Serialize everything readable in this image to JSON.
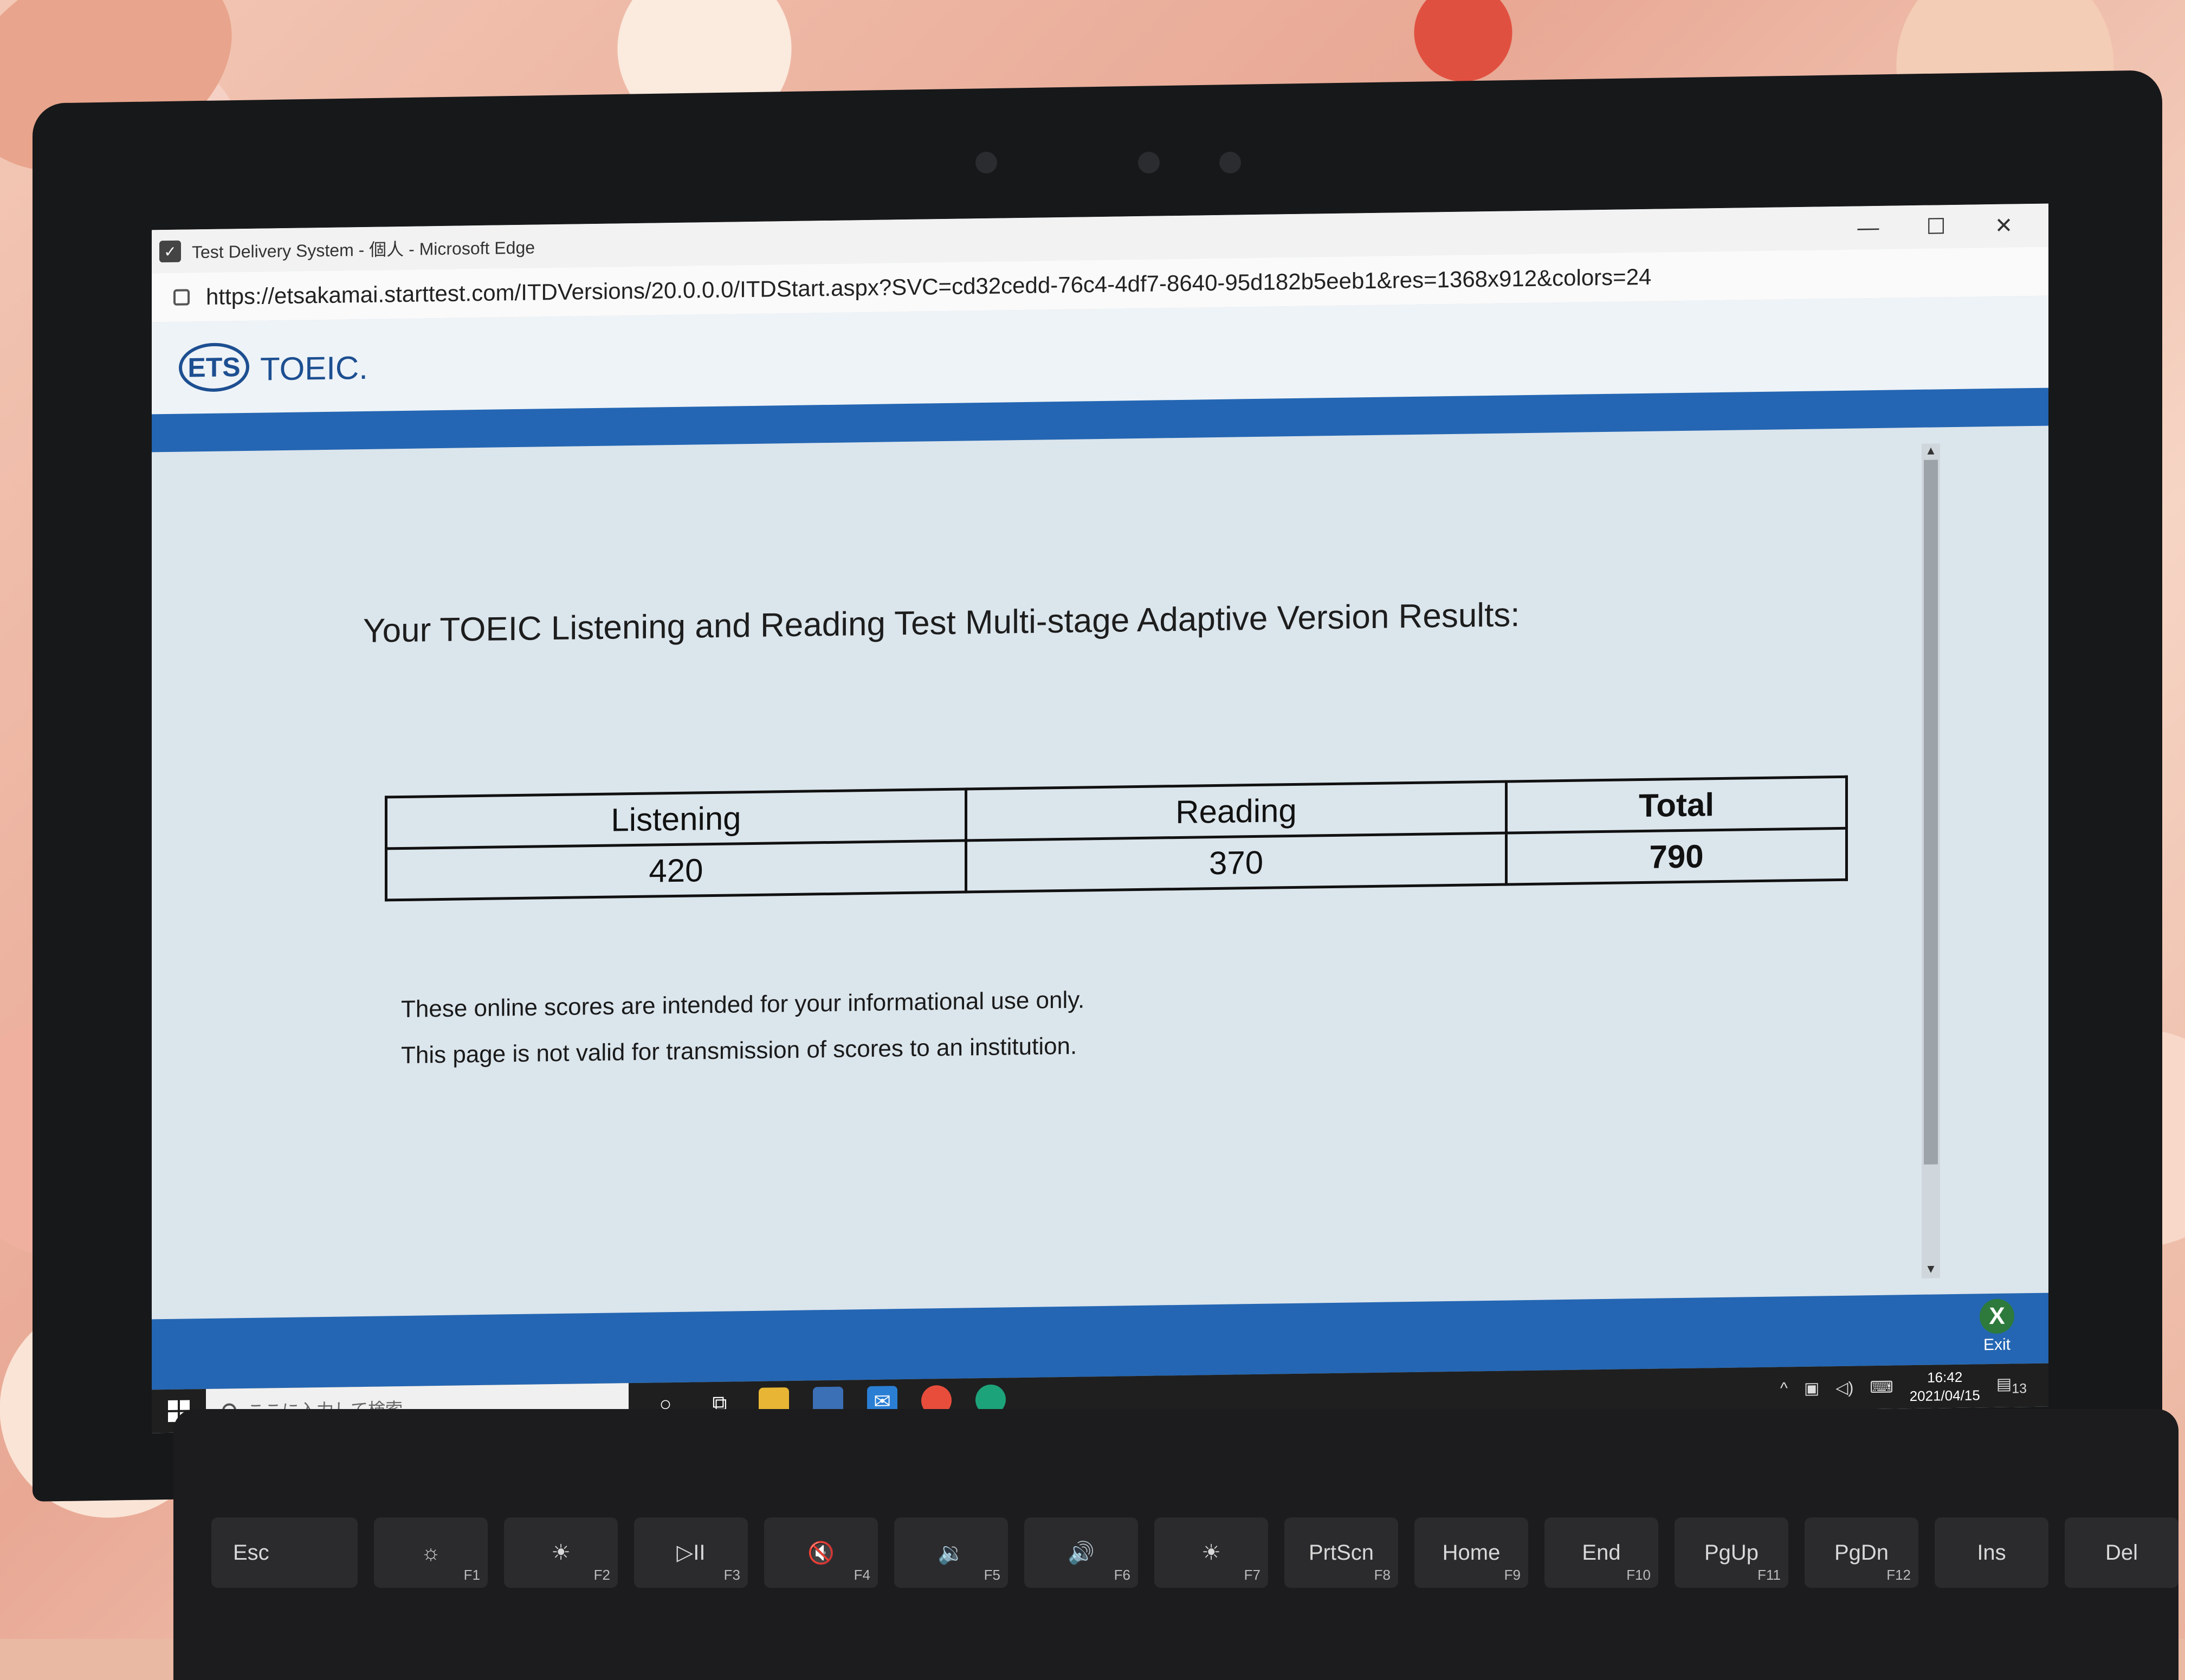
{
  "window": {
    "title": "Test Delivery System - 個人 - Microsoft Edge",
    "minimize": "—",
    "maximize": "☐",
    "close": "✕"
  },
  "address": {
    "url": "https://etsakamai.starttest.com/ITDVersions/20.0.0.0/ITDStart.aspx?SVC=cd32cedd-76c4-4df7-8640-95d182b5eeb1&res=1368x912&colors=24"
  },
  "header": {
    "logo_ets": "ETS",
    "logo_toeic": "TOEIC."
  },
  "results": {
    "title": "Your TOEIC Listening and Reading Test Multi-stage Adaptive Version Results:",
    "columns": [
      "Listening",
      "Reading",
      "Total"
    ],
    "scores": [
      "420",
      "370",
      "790"
    ]
  },
  "notes": [
    "These online scores are intended for your informational use only.",
    "This page is not valid for transmission of scores to an institution."
  ],
  "exit": {
    "icon": "X",
    "label": "Exit"
  },
  "taskbar": {
    "search_placeholder": "ここに入力して検索",
    "time": "16:42",
    "date": "2021/04/15",
    "notification_count": "13"
  },
  "keyboard": {
    "keys": [
      {
        "label": "Esc",
        "fn": ""
      },
      {
        "label": "☼",
        "fn": "F1"
      },
      {
        "label": "☀",
        "fn": "F2"
      },
      {
        "label": "▷II",
        "fn": "F3"
      },
      {
        "label": "🔇",
        "fn": "F4"
      },
      {
        "label": "🔉",
        "fn": "F5"
      },
      {
        "label": "🔊",
        "fn": "F6"
      },
      {
        "label": "☀",
        "fn": "F7"
      },
      {
        "label": "PrtScn",
        "fn": "F8"
      },
      {
        "label": "Home",
        "fn": "F9"
      },
      {
        "label": "End",
        "fn": "F10"
      },
      {
        "label": "PgUp",
        "fn": "F11"
      },
      {
        "label": "PgDn",
        "fn": "F12"
      },
      {
        "label": "Ins",
        "fn": ""
      },
      {
        "label": "Del",
        "fn": ""
      }
    ]
  },
  "colors": {
    "brand_blue": "#2466b3",
    "logo_blue": "#1d4f91",
    "page_bg": "#dbe5ec"
  }
}
